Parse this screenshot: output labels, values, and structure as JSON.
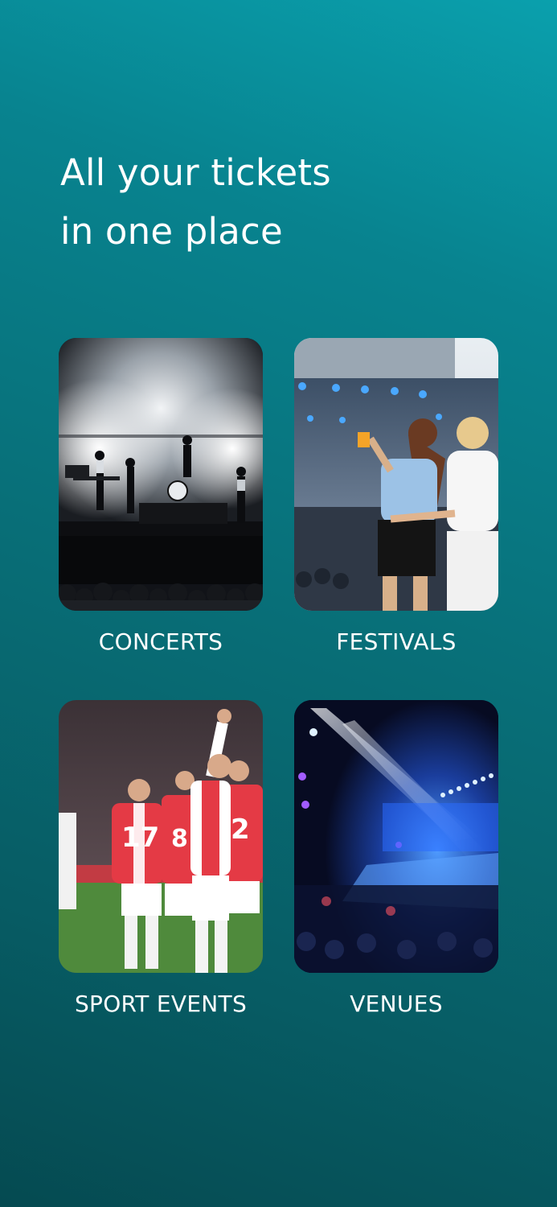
{
  "headline": {
    "line1": "All your tickets",
    "line2": "in one place"
  },
  "categories": [
    {
      "label": "CONCERTS",
      "image": "concert-stage-photo"
    },
    {
      "label": "FESTIVALS",
      "image": "festival-crowd-photo"
    },
    {
      "label": "SPORT EVENTS",
      "image": "football-players-photo"
    },
    {
      "label": "VENUES",
      "image": "arena-venue-photo"
    }
  ],
  "colors": {
    "background_top": "#0aa0ad",
    "background_bottom": "#054a51",
    "text": "#ffffff"
  }
}
